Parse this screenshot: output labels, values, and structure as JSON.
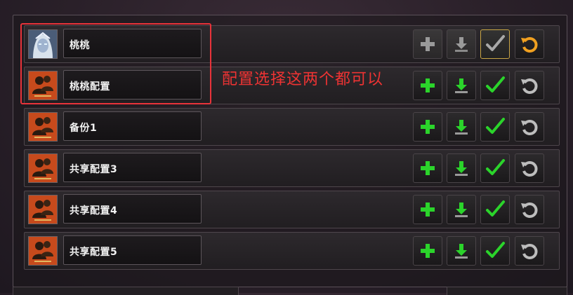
{
  "profiles": [
    {
      "name": "桃桃",
      "avatar": "character-portrait-icon",
      "add": "disabled",
      "download": "disabled",
      "apply": "selected",
      "reset": "active"
    },
    {
      "name": "桃桃配置",
      "avatar": "shared-profile-icon",
      "add": "enabled",
      "download": "enabled",
      "apply": "enabled",
      "reset": "enabled"
    },
    {
      "name": "备份1",
      "avatar": "shared-profile-icon",
      "add": "enabled",
      "download": "enabled",
      "apply": "enabled",
      "reset": "enabled"
    },
    {
      "name": "共享配置3",
      "avatar": "shared-profile-icon",
      "add": "enabled",
      "download": "enabled",
      "apply": "enabled",
      "reset": "enabled"
    },
    {
      "name": "共享配置4",
      "avatar": "shared-profile-icon",
      "add": "enabled",
      "download": "enabled",
      "apply": "enabled",
      "reset": "enabled"
    },
    {
      "name": "共享配置5",
      "avatar": "shared-profile-icon",
      "add": "enabled",
      "download": "enabled",
      "apply": "enabled",
      "reset": "enabled"
    }
  ],
  "annotation": {
    "text": "配置选择这两个都可以",
    "color": "#ee3333"
  },
  "colors": {
    "plus": "#2bd42b",
    "download": "#2bd42b",
    "check": "#2bd42b",
    "reset_active": "#f0a020",
    "disabled": "#9a9a9a"
  }
}
